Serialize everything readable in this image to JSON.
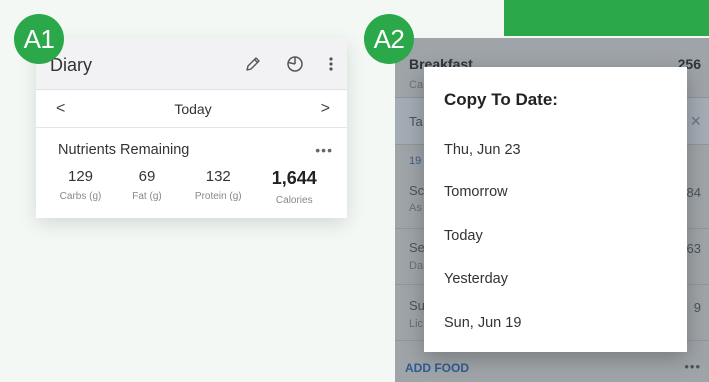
{
  "badges": {
    "a1": "A1",
    "a2": "A2"
  },
  "diary": {
    "title": "Diary",
    "icons": [
      "pencil-icon",
      "pie-chart-icon",
      "more-vertical-icon"
    ],
    "date_nav": {
      "prev": "<",
      "label": "Today",
      "next": ">"
    },
    "nutrients": {
      "title": "Nutrients Remaining",
      "more": "•••",
      "items": [
        {
          "value": "129",
          "label": "Carbs (g)"
        },
        {
          "value": "69",
          "label": "Fat (g)"
        },
        {
          "value": "132",
          "label": "Protein (g)"
        },
        {
          "value": "1,644",
          "label": "Calories"
        }
      ]
    }
  },
  "background_list": {
    "meal": "Breakfast",
    "meal_value": "256",
    "meal_sub": "Ca",
    "tab_label": "Ta",
    "close": "×",
    "time": "19",
    "rows": [
      {
        "label": "Sc",
        "sub": "As",
        "value": "84"
      },
      {
        "label": "Se",
        "sub": "Da",
        "value": "63"
      },
      {
        "label": "Su",
        "sub": "Lic",
        "value": "9"
      }
    ],
    "add_food": "ADD FOOD",
    "add_more": "•••"
  },
  "copy_dialog": {
    "title": "Copy To Date:",
    "options": [
      "Thu, Jun 23",
      "Tomorrow",
      "Today",
      "Yesterday",
      "Sun, Jun 19"
    ]
  },
  "colors": {
    "accent_green": "#2aa84a",
    "overlay_gray": "#9fa4a8",
    "link_blue": "#315b93"
  }
}
